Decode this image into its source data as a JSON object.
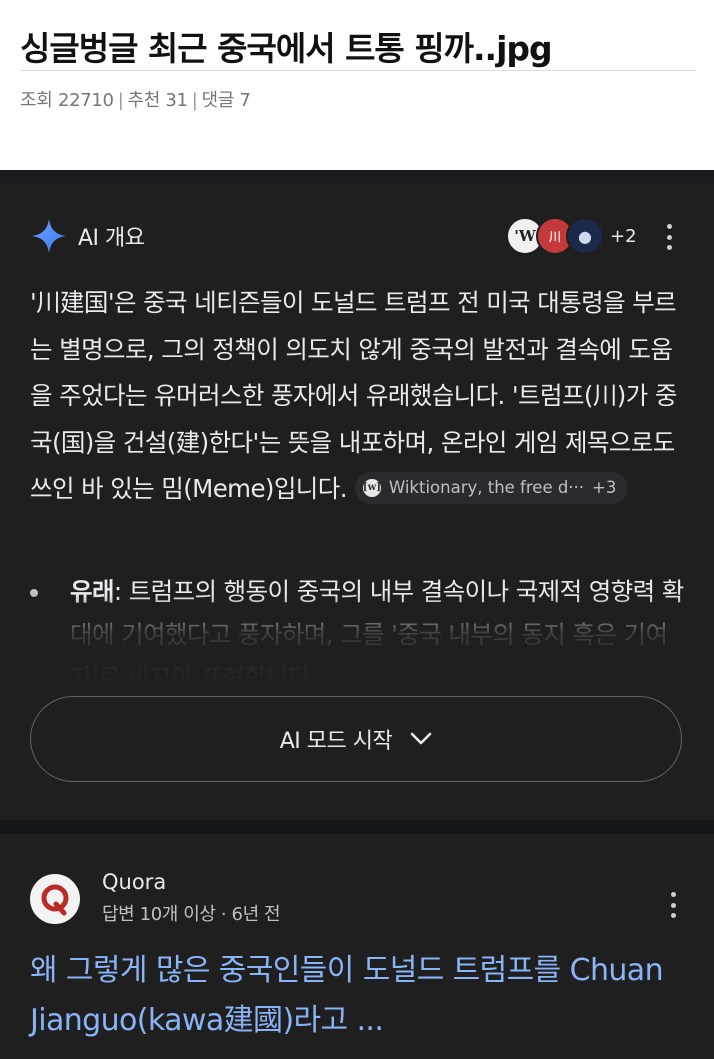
{
  "post": {
    "title": "싱글벙글 최근 중국에서 트통 핑까..jpg",
    "views_label": "조회 22710",
    "recommend_label": "추천 31",
    "comments_label": "댓글 7",
    "separator": "|"
  },
  "ai_overview": {
    "title": "AI 개요",
    "sparkle_icon": "sparkle-icon",
    "source_icons": [
      {
        "icon": "wiktionary-icon",
        "glyph": "'W"
      },
      {
        "icon": "ruliweb-icon",
        "glyph": "川"
      },
      {
        "icon": "steam-icon",
        "glyph": "●"
      }
    ],
    "more_sources": "+2",
    "paragraph": "'川建国'은 중국 네티즌들이 도널드 트럼프 전 미국 대통령을 부르는 별명으로, 그의 정책이 의도치 않게 중국의 발전과 결속에 도움을 주었다는 유머러스한 풍자에서 유래했습니다. '트럼프(川)가 중국(国)을 건설(建)한다'는 뜻을 내포하며, 온라인 게임 제목으로도 쓰인 바 있는 밈(Meme)입니다.",
    "citation": {
      "label": "Wiktionary, the free d···",
      "count": "+3",
      "icon_glyph": "[w]"
    },
    "bullet": {
      "term": "유래",
      "text": ": 트럼프의 행동이 중국의 내부 결속이나 국제적 영향력 확대에 기여했다고 풍자하며, 그를 '중국 내부의 동지 혹은 기여자'로 비꼬아 표현합니다."
    },
    "mode_button": "AI 모드 시작",
    "accent_color": "#4c8df6"
  },
  "quora_result": {
    "site": "Quora",
    "meta": "답변 10개 이상 · 6년 전",
    "link_text": "왜 그렇게 많은 중국인들이 도널드 트럼프를 Chuan Jianguo(kawa建國)라고 ...",
    "link_color": "#8ab4f8"
  }
}
